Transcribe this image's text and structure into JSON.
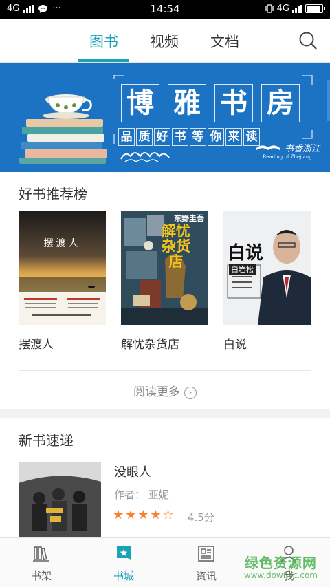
{
  "status_bar": {
    "network_left": "4G",
    "time": "14:54",
    "network_right": "4G"
  },
  "top_tabs": {
    "tabs": [
      {
        "label": "图书",
        "active": true
      },
      {
        "label": "视频",
        "active": false
      },
      {
        "label": "文档",
        "active": false
      }
    ],
    "search_icon": "search-icon",
    "accent_color": "#1aa3b6"
  },
  "banner": {
    "title_chars": [
      "博",
      "雅",
      "书",
      "房"
    ],
    "subtitle_chars": [
      "品",
      "质",
      "好",
      "书",
      "等",
      "你",
      "来",
      "读"
    ],
    "logo_text": "书香浙江",
    "logo_subtext": "Reading of Zhejiang",
    "background_color": "#1c73c4"
  },
  "recommend": {
    "title": "好书推荐榜",
    "books": [
      {
        "title": "摆渡人",
        "cover_title": "摆渡人"
      },
      {
        "title": "解忧杂货店",
        "cover_title": "解忧杂货店",
        "cover_author": "东野圭吾"
      },
      {
        "title": "白说",
        "cover_title": "白说",
        "cover_author": "白岩松"
      }
    ],
    "more_label": "阅读更多"
  },
  "new_books": {
    "title": "新书速递",
    "items": [
      {
        "title": "没眼人",
        "author_label": "作者：",
        "author": "亚妮",
        "rating_stars": 4.5,
        "stars_text": "★★★★☆",
        "score_text": "4.5分"
      }
    ]
  },
  "bottom_nav": {
    "items": [
      {
        "label": "书架",
        "icon": "bookshelf-icon",
        "active": false
      },
      {
        "label": "书城",
        "icon": "bookstore-icon",
        "active": true
      },
      {
        "label": "资讯",
        "icon": "news-icon",
        "active": false
      },
      {
        "label": "我",
        "icon": "profile-icon",
        "active": false
      }
    ]
  },
  "watermark": {
    "main": "绿色资源网",
    "sub": "www.downcc.com"
  }
}
